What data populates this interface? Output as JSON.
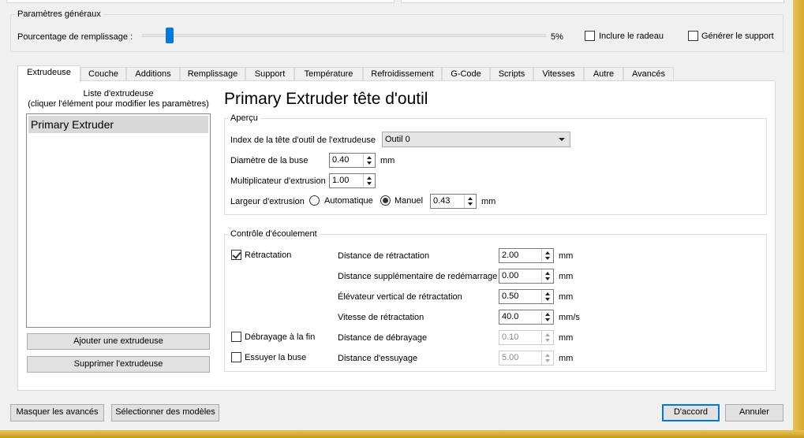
{
  "general": {
    "title": "Paramètres généraux",
    "fill_label": "Pourcentage de remplissage :",
    "fill_value": "5%",
    "fill_fraction": 0.05,
    "raft_label": "Inclure le radeau",
    "raft_checked": false,
    "support_label": "Générer le support",
    "support_checked": false
  },
  "tabs": [
    {
      "label": "Extrudeuse",
      "active": true
    },
    {
      "label": "Couche"
    },
    {
      "label": "Additions"
    },
    {
      "label": "Remplissage"
    },
    {
      "label": "Support"
    },
    {
      "label": "Température"
    },
    {
      "label": "Refroidissement"
    },
    {
      "label": "G-Code"
    },
    {
      "label": "Scripts"
    },
    {
      "label": "Vitesses"
    },
    {
      "label": "Autre"
    },
    {
      "label": "Avancés"
    }
  ],
  "extruder_list": {
    "heading_line1": "Liste d'extrudeuse",
    "heading_line2": "(cliquer l'élément pour modifier les paramètres)",
    "items": [
      "Primary Extruder"
    ],
    "add_button": "Ajouter une extrudeuse",
    "remove_button": "Supprimer l'extrudeuse"
  },
  "panel_title": "Primary Extruder tête d'outil",
  "overview": {
    "title": "Aperçu",
    "toolhead_index_label": "Index de la tête d'outil de l'extrudeuse",
    "toolhead_index_value": "Outil 0",
    "nozzle_diameter_label": "Diamètre de la buse",
    "nozzle_diameter_value": "0.40",
    "nozzle_diameter_unit": "mm",
    "extrusion_multiplier_label": "Multiplicateur d'extrusion",
    "extrusion_multiplier_value": "1.00",
    "extrusion_width_label": "Largeur d'extrusion",
    "auto_label": "Automatique",
    "manual_label": "Manuel",
    "extrusion_width_mode": "Manuel",
    "extrusion_width_value": "0.43",
    "extrusion_width_unit": "mm"
  },
  "flow": {
    "title": "Contrôle d'écoulement",
    "retraction_label": "Rétractation",
    "retraction_checked": true,
    "retraction_distance_label": "Distance de rétractation",
    "retraction_distance_value": "2.00",
    "retraction_distance_unit": "mm",
    "extra_restart_label": "Distance supplémentaire de redémarrage",
    "extra_restart_value": "0.00",
    "extra_restart_unit": "mm",
    "vertical_lift_label": "Élévateur vertical de rétractation",
    "vertical_lift_value": "0.50",
    "vertical_lift_unit": "mm",
    "retraction_speed_label": "Vitesse de rétractation",
    "retraction_speed_value": "40.0",
    "retraction_speed_unit": "mm/s",
    "coast_label": "Débrayage à la fin",
    "coast_checked": false,
    "coast_distance_label": "Distance de débrayage",
    "coast_distance_value": "0.10",
    "coast_distance_unit": "mm",
    "wipe_label": "Essuyer la buse",
    "wipe_checked": false,
    "wipe_distance_label": "Distance d'essuyage",
    "wipe_distance_value": "5.00",
    "wipe_distance_unit": "mm"
  },
  "footer": {
    "hide_advanced": "Masquer les avancés",
    "select_models": "Sélectionner des modèles",
    "ok": "D'accord",
    "cancel": "Annuler"
  }
}
